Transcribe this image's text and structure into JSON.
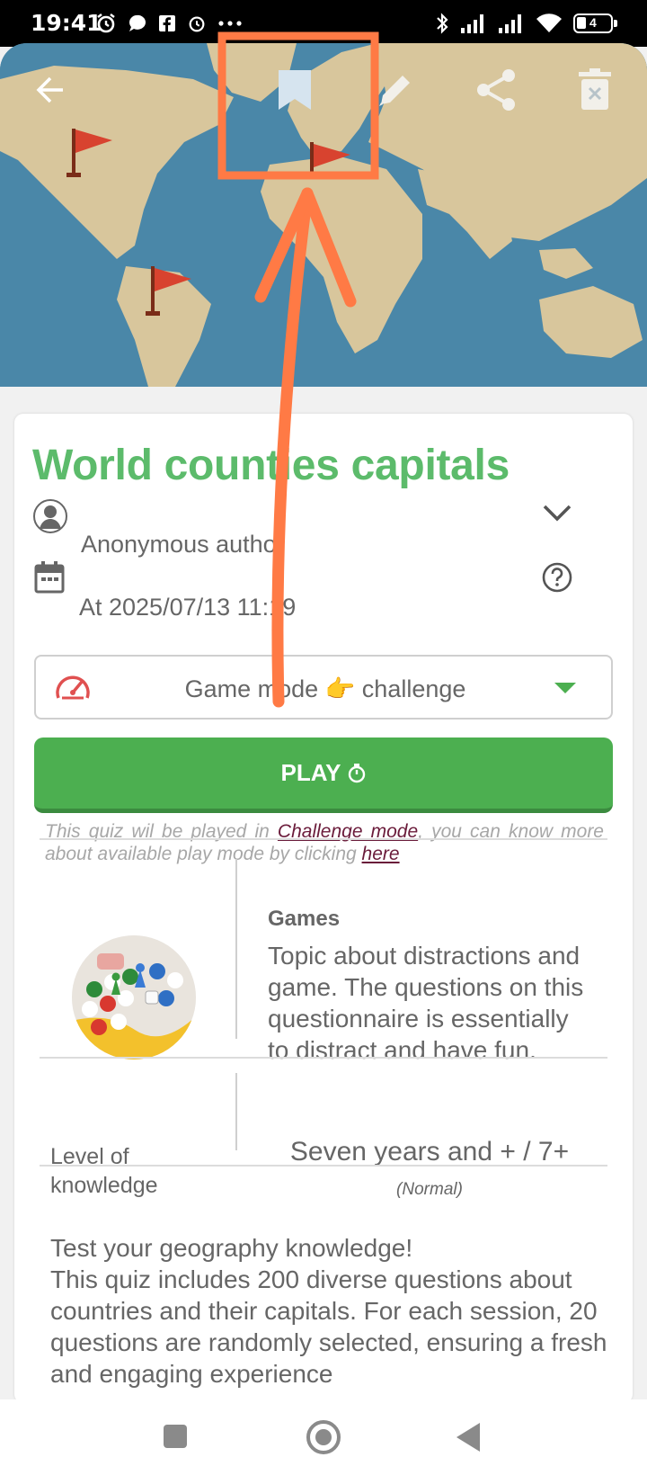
{
  "status_bar": {
    "time": "19:41",
    "battery": "4"
  },
  "quiz": {
    "title": "World counties capitals",
    "author": "Anonymous autho",
    "date": "At 2025/07/13 11:19",
    "game_mode": "Game mode 👉 challenge",
    "play_label": "PLAY",
    "note": {
      "part1": "This quiz wil be played in ",
      "mode_link": "Challenge mode",
      "part2": ", you can know more about available play mode by clicking ",
      "here_link": "here"
    },
    "topic": {
      "name": "Games",
      "description": "Topic about distractions and game. The questions on this questionnaire is essentially to distract and have fun."
    },
    "level": {
      "label": "Level of knowledge",
      "value": "Seven years and + / 7+",
      "sub": "(Normal)"
    },
    "description": "Test your geography knowledge!\nThis quiz includes 200 diverse questions about countries and their capitals. For each session, 20 questions are randomly selected, ensuring a fresh and engaging experience"
  },
  "icons": {
    "back": "arrow-left-icon",
    "bookmark": "bookmark-icon",
    "edit": "pencil-icon",
    "share": "share-icon",
    "delete": "trash-icon",
    "author": "person-icon",
    "calendar": "calendar-icon",
    "help": "help-circle-icon",
    "expand": "chevron-down-icon",
    "speed": "speedometer-icon",
    "dropdown": "triangle-down-icon"
  },
  "colors": {
    "title_green": "#5cbb6b",
    "play_green": "#4caf50",
    "annotation_orange": "#ff7a45",
    "link_maroon": "#6a1b3a"
  }
}
